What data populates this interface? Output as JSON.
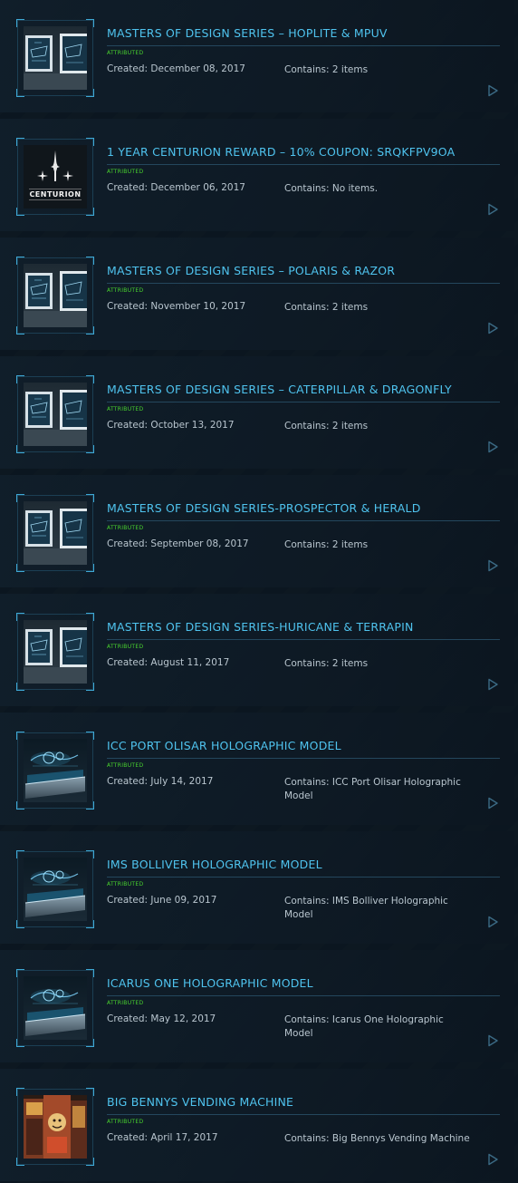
{
  "pledges": [
    {
      "title": "MASTERS OF DESIGN SERIES – HOPLITE & MPUV",
      "status": "ATTRIBUTED",
      "created": "Created: December 08, 2017",
      "contains": "Contains: 2 items",
      "thumbnail": "frames"
    },
    {
      "title": "1 YEAR CENTURION REWARD – 10% COUPON: SRQKFPV9OA",
      "status": "ATTRIBUTED",
      "created": "Created: December 06, 2017",
      "contains": "Contains: No items.",
      "thumbnail": "centurion",
      "thumbnail_text": "CENTURION"
    },
    {
      "title": "MASTERS OF DESIGN SERIES – POLARIS & RAZOR",
      "status": "ATTRIBUTED",
      "created": "Created: November 10, 2017",
      "contains": "Contains: 2 items",
      "thumbnail": "frames"
    },
    {
      "title": "MASTERS OF DESIGN SERIES – CATERPILLAR & DRAGONFLY",
      "status": "ATTRIBUTED",
      "created": "Created: October 13, 2017",
      "contains": "Contains: 2 items",
      "thumbnail": "frames"
    },
    {
      "title": "MASTERS OF DESIGN SERIES-PROSPECTOR & HERALD",
      "status": "ATTRIBUTED",
      "created": "Created: September 08, 2017",
      "contains": "Contains: 2 items",
      "thumbnail": "frames"
    },
    {
      "title": "MASTERS OF DESIGN SERIES-HURICANE & TERRAPIN",
      "status": "ATTRIBUTED",
      "created": "Created: August 11, 2017",
      "contains": "Contains: 2 items",
      "thumbnail": "frames"
    },
    {
      "title": "ICC PORT OLISAR HOLOGRAPHIC MODEL",
      "status": "ATTRIBUTED",
      "created": "Created: July 14, 2017",
      "contains": "Contains: ICC Port Olisar Holographic Model",
      "thumbnail": "hologram"
    },
    {
      "title": "IMS BOLLIVER HOLOGRAPHIC MODEL",
      "status": "ATTRIBUTED",
      "created": "Created: June 09, 2017",
      "contains": "Contains: IMS Bolliver Holographic Model",
      "thumbnail": "hologram"
    },
    {
      "title": "ICARUS ONE HOLOGRAPHIC MODEL",
      "status": "ATTRIBUTED",
      "created": "Created: May 12, 2017",
      "contains": "Contains: Icarus One Holographic Model",
      "thumbnail": "hologram"
    },
    {
      "title": "BIG BENNYS VENDING MACHINE",
      "status": "ATTRIBUTED",
      "created": "Created: April 17, 2017",
      "contains": "Contains: Big Bennys Vending Machine",
      "thumbnail": "vending"
    }
  ],
  "colors": {
    "title": "#4fc3ee",
    "attributed": "#49d42e",
    "meta": "#b9c6cf",
    "accent": "#3fa9d6"
  },
  "icons": {
    "expand": "play-triangle-icon"
  }
}
